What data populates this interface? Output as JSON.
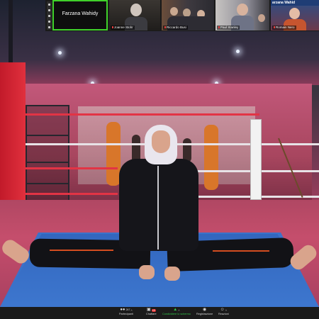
{
  "participants": [
    {
      "name": "Farzana Wahidy",
      "active": true
    },
    {
      "name": "Joanne Stohr",
      "active": false
    },
    {
      "name": "Riccardo Busi",
      "active": false
    },
    {
      "name": "Paul Stanley",
      "active": false
    },
    {
      "name": "Romain Nero",
      "active": false
    }
  ],
  "tile_overlay_text": "arzana Wahid",
  "toolbar": {
    "participants": {
      "label": "Partecipanti",
      "count": "247"
    },
    "chat": {
      "label": "Chattare",
      "badge": "18"
    },
    "share": {
      "label": "Condividere lo schermo"
    },
    "record": {
      "label": "Registrazione"
    },
    "reactions": {
      "label": "Reazioni"
    }
  },
  "colors": {
    "active_speaker_border": "#3fd12a",
    "share_accent": "#32c84a",
    "badge": "#e02929"
  },
  "icons": [
    "participants-icon",
    "chat-icon",
    "share-screen-icon",
    "record-icon",
    "reactions-icon"
  ]
}
